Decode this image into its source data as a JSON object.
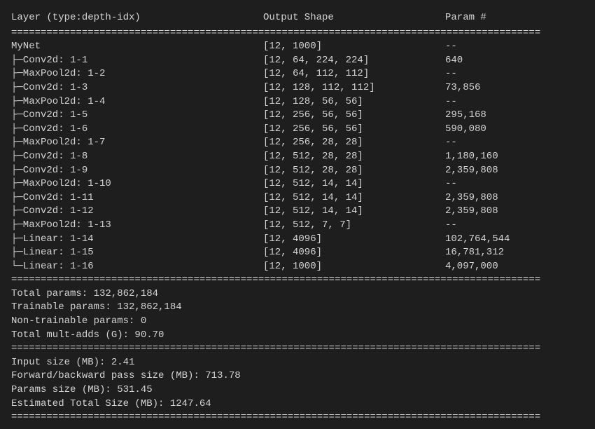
{
  "header": {
    "col1": "Layer (type:depth-idx)",
    "col2": "Output Shape",
    "col3": "Param #"
  },
  "divider": "==========================================================================================",
  "rows": [
    {
      "layer": "MyNet",
      "prefix": "",
      "shape": "[12, 1000]",
      "param": "--"
    },
    {
      "layer": "Conv2d: 1-1",
      "prefix": "├─",
      "shape": "[12, 64, 224, 224]",
      "param": "640"
    },
    {
      "layer": "MaxPool2d: 1-2",
      "prefix": "├─",
      "shape": "[12, 64, 112, 112]",
      "param": "--"
    },
    {
      "layer": "Conv2d: 1-3",
      "prefix": "├─",
      "shape": "[12, 128, 112, 112]",
      "param": "73,856"
    },
    {
      "layer": "MaxPool2d: 1-4",
      "prefix": "├─",
      "shape": "[12, 128, 56, 56]",
      "param": "--"
    },
    {
      "layer": "Conv2d: 1-5",
      "prefix": "├─",
      "shape": "[12, 256, 56, 56]",
      "param": "295,168"
    },
    {
      "layer": "Conv2d: 1-6",
      "prefix": "├─",
      "shape": "[12, 256, 56, 56]",
      "param": "590,080"
    },
    {
      "layer": "MaxPool2d: 1-7",
      "prefix": "├─",
      "shape": "[12, 256, 28, 28]",
      "param": "--"
    },
    {
      "layer": "Conv2d: 1-8",
      "prefix": "├─",
      "shape": "[12, 512, 28, 28]",
      "param": "1,180,160"
    },
    {
      "layer": "Conv2d: 1-9",
      "prefix": "├─",
      "shape": "[12, 512, 28, 28]",
      "param": "2,359,808"
    },
    {
      "layer": "MaxPool2d: 1-10",
      "prefix": "├─",
      "shape": "[12, 512, 14, 14]",
      "param": "--"
    },
    {
      "layer": "Conv2d: 1-11",
      "prefix": "├─",
      "shape": "[12, 512, 14, 14]",
      "param": "2,359,808"
    },
    {
      "layer": "Conv2d: 1-12",
      "prefix": "├─",
      "shape": "[12, 512, 14, 14]",
      "param": "2,359,808"
    },
    {
      "layer": "MaxPool2d: 1-13",
      "prefix": "├─",
      "shape": "[12, 512, 7, 7]",
      "param": "--"
    },
    {
      "layer": "Linear: 1-14",
      "prefix": "├─",
      "shape": "[12, 4096]",
      "param": "102,764,544"
    },
    {
      "layer": "Linear: 1-15",
      "prefix": "├─",
      "shape": "[12, 4096]",
      "param": "16,781,312"
    },
    {
      "layer": "Linear: 1-16",
      "prefix": "└─",
      "shape": "[12, 1000]",
      "param": "4,097,000"
    }
  ],
  "summary1": {
    "total_params": "Total params: 132,862,184",
    "trainable_params": "Trainable params: 132,862,184",
    "non_trainable_params": "Non-trainable params: 0",
    "mult_adds": "Total mult-adds (G): 90.70"
  },
  "summary2": {
    "input_size": "Input size (MB): 2.41",
    "fwd_bwd_size": "Forward/backward pass size (MB): 713.78",
    "params_size": "Params size (MB): 531.45",
    "total_size": "Estimated Total Size (MB): 1247.64"
  }
}
